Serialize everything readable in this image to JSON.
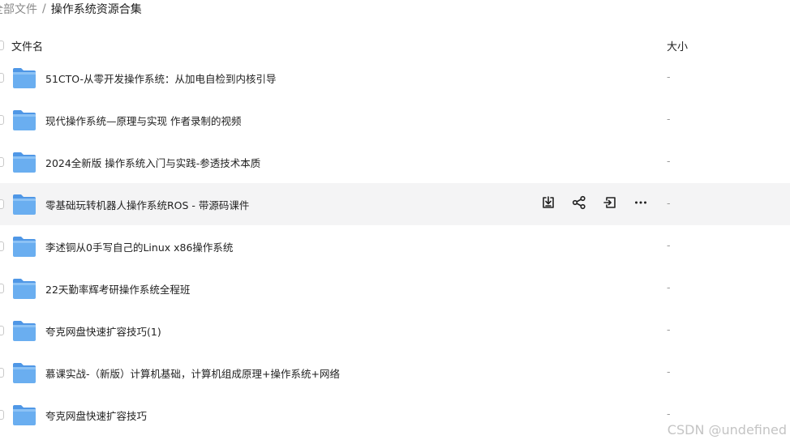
{
  "breadcrumb": {
    "root": "全部文件",
    "separator": "/",
    "current": "操作系统资源合集"
  },
  "table": {
    "columns": {
      "name": "文件名",
      "size": "大小"
    },
    "rows": [
      {
        "name": "51CTO-从零开发操作系统：从加电自检到内核引导",
        "size": "-"
      },
      {
        "name": "现代操作系统—原理与实现 作者录制的视频",
        "size": "-"
      },
      {
        "name": "2024全新版 操作系统入门与实践-参透技术本质",
        "size": "-"
      },
      {
        "name": "零基础玩转机器人操作系统ROS - 带源码课件",
        "size": "-"
      },
      {
        "name": "李述铜从0手写自己的Linux x86操作系统",
        "size": "-"
      },
      {
        "name": "22天勤率辉考研操作系统全程班",
        "size": "-"
      },
      {
        "name": "夸克网盘快速扩容技巧(1)",
        "size": "-"
      },
      {
        "name": "慕课实战-（新版）计算机基础，计算机组成原理+操作系统+网络",
        "size": "-"
      },
      {
        "name": "夸克网盘快速扩容技巧",
        "size": "-"
      }
    ],
    "hovered_row": 3,
    "row_actions": [
      "download-icon",
      "share-icon",
      "move-icon",
      "more-icon"
    ]
  },
  "colors": {
    "folder": "#6aaef0",
    "hover_bg": "#f4f4f5"
  },
  "watermark": "CSDN @undefined"
}
